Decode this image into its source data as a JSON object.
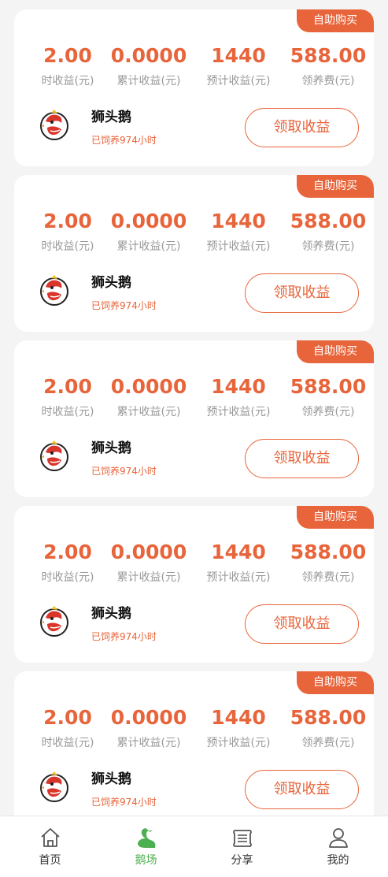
{
  "cards": [
    {
      "tag": "自助购买",
      "stats": [
        {
          "value": "2.00",
          "label": "时收益(元)"
        },
        {
          "value": "0.0000",
          "label": "累计收益(元)"
        },
        {
          "value": "1440",
          "label": "预计收益(元)"
        },
        {
          "value": "588.00",
          "label": "领养费(元)"
        }
      ],
      "name": "狮头鹅",
      "hours": "已饲养974小时",
      "button": "领取收益"
    },
    {
      "tag": "自助购买",
      "stats": [
        {
          "value": "2.00",
          "label": "时收益(元)"
        },
        {
          "value": "0.0000",
          "label": "累计收益(元)"
        },
        {
          "value": "1440",
          "label": "预计收益(元)"
        },
        {
          "value": "588.00",
          "label": "领养费(元)"
        }
      ],
      "name": "狮头鹅",
      "hours": "已饲养974小时",
      "button": "领取收益"
    },
    {
      "tag": "自助购买",
      "stats": [
        {
          "value": "2.00",
          "label": "时收益(元)"
        },
        {
          "value": "0.0000",
          "label": "累计收益(元)"
        },
        {
          "value": "1440",
          "label": "预计收益(元)"
        },
        {
          "value": "588.00",
          "label": "领养费(元)"
        }
      ],
      "name": "狮头鹅",
      "hours": "已饲养974小时",
      "button": "领取收益"
    },
    {
      "tag": "自助购买",
      "stats": [
        {
          "value": "2.00",
          "label": "时收益(元)"
        },
        {
          "value": "0.0000",
          "label": "累计收益(元)"
        },
        {
          "value": "1440",
          "label": "预计收益(元)"
        },
        {
          "value": "588.00",
          "label": "领养费(元)"
        }
      ],
      "name": "狮头鹅",
      "hours": "已饲养974小时",
      "button": "领取收益"
    },
    {
      "tag": "自助购买",
      "stats": [
        {
          "value": "2.00",
          "label": "时收益(元)"
        },
        {
          "value": "0.0000",
          "label": "累计收益(元)"
        },
        {
          "value": "1440",
          "label": "预计收益(元)"
        },
        {
          "value": "588.00",
          "label": "领养费(元)"
        }
      ],
      "name": "狮头鹅",
      "hours": "已饲养974小时",
      "button": "领取收益"
    }
  ],
  "tabbar": [
    {
      "label": "首页",
      "icon": "home-icon",
      "active": false
    },
    {
      "label": "鹅场",
      "icon": "goose-icon",
      "active": true
    },
    {
      "label": "分享",
      "icon": "share-list-icon",
      "active": false
    },
    {
      "label": "我的",
      "icon": "user-icon",
      "active": false
    }
  ],
  "colors": {
    "accent": "#e8643a",
    "active_tab": "#4caf50",
    "muted_text": "#999999",
    "background": "#f4f4f4"
  }
}
